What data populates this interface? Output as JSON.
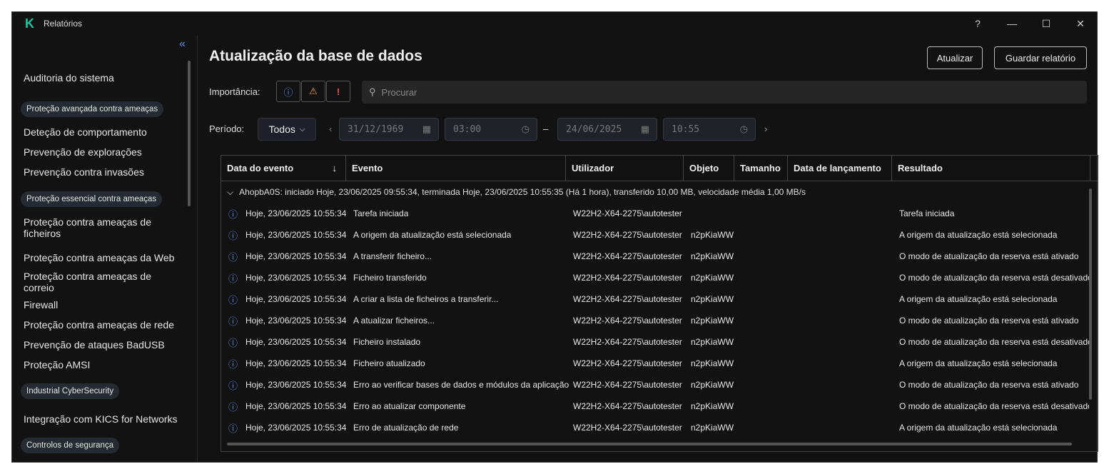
{
  "window": {
    "title": "Relatórios",
    "logo": "K",
    "help": "?",
    "minimize": "—",
    "maximize": "☐",
    "close": "✕"
  },
  "sidebar": {
    "collapse": "«",
    "items": [
      {
        "type": "item",
        "label": "Auditoria do sistema"
      },
      {
        "type": "cat",
        "label": "Proteção avançada contra ameaças"
      },
      {
        "type": "item",
        "label": "Deteção de comportamento"
      },
      {
        "type": "item",
        "label": "Prevenção de explorações"
      },
      {
        "type": "item",
        "label": "Prevenção contra invasões"
      },
      {
        "type": "cat",
        "label": "Proteção essencial contra ameaças"
      },
      {
        "type": "item",
        "label": "Proteção contra ameaças de ficheiros"
      },
      {
        "type": "item",
        "label": "Proteção contra ameaças da Web"
      },
      {
        "type": "item",
        "label": "Proteção contra ameaças de correio"
      },
      {
        "type": "item",
        "label": "Firewall"
      },
      {
        "type": "item",
        "label": "Proteção contra ameaças de rede"
      },
      {
        "type": "item",
        "label": "Prevenção de ataques BadUSB"
      },
      {
        "type": "item",
        "label": "Proteção AMSI"
      },
      {
        "type": "cat",
        "label": "Industrial CyberSecurity"
      },
      {
        "type": "item",
        "label": "Integração com KICS for Networks"
      },
      {
        "type": "cat",
        "label": "Controlos de segurança"
      }
    ]
  },
  "main": {
    "title": "Atualização da base de dados",
    "refresh": "Atualizar",
    "save": "Guardar relatório",
    "importance_label": "Importância:",
    "search_placeholder": "Procurar",
    "period_label": "Período:",
    "period_value": "Todos",
    "from_date": "31/12/1969",
    "from_time": "03:00",
    "dash": "–",
    "to_date": "24/06/2025",
    "to_time": "10:55"
  },
  "table": {
    "columns": [
      "Data do evento",
      "Evento",
      "Utilizador",
      "Objeto",
      "Tamanho",
      "Data de lançamento",
      "Resultado"
    ],
    "sort_icon": "↓",
    "group": "AhopbA0S: iniciado Hoje, 23/06/2025 09:55:34, terminada Hoje, 23/06/2025 10:55:35 (Há 1 hora), transferido 10,00 MB, velocidade média 1,00 MB/s",
    "rows": [
      {
        "date": "Hoje, 23/06/2025 10:55:34",
        "event": "Tarefa iniciada",
        "user": "W22H2-X64-2275\\autotester",
        "object": "",
        "result": "Tarefa iniciada"
      },
      {
        "date": "Hoje, 23/06/2025 10:55:34",
        "event": "A origem da atualização está selecionada",
        "user": "W22H2-X64-2275\\autotester",
        "object": "n2pKiaWW",
        "result": "A origem da atualização está selecionada"
      },
      {
        "date": "Hoje, 23/06/2025 10:55:34",
        "event": "A transferir ficheiro...",
        "user": "W22H2-X64-2275\\autotester",
        "object": "n2pKiaWW",
        "result": "O modo de atualização da reserva está ativado"
      },
      {
        "date": "Hoje, 23/06/2025 10:55:34",
        "event": "Ficheiro transferido",
        "user": "W22H2-X64-2275\\autotester",
        "object": "n2pKiaWW",
        "result": "O modo de atualização da reserva está desativado"
      },
      {
        "date": "Hoje, 23/06/2025 10:55:34",
        "event": "A criar a lista de ficheiros a transferir...",
        "user": "W22H2-X64-2275\\autotester",
        "object": "n2pKiaWW",
        "result": "A origem da atualização está selecionada"
      },
      {
        "date": "Hoje, 23/06/2025 10:55:34",
        "event": "A atualizar ficheiros...",
        "user": "W22H2-X64-2275\\autotester",
        "object": "n2pKiaWW",
        "result": "O modo de atualização da reserva está ativado"
      },
      {
        "date": "Hoje, 23/06/2025 10:55:34",
        "event": "Ficheiro instalado",
        "user": "W22H2-X64-2275\\autotester",
        "object": "n2pKiaWW",
        "result": "O modo de atualização da reserva está desativado"
      },
      {
        "date": "Hoje, 23/06/2025 10:55:34",
        "event": "Ficheiro atualizado",
        "user": "W22H2-X64-2275\\autotester",
        "object": "n2pKiaWW",
        "result": "A origem da atualização está selecionada"
      },
      {
        "date": "Hoje, 23/06/2025 10:55:34",
        "event": "Erro ao verificar bases de dados e módulos da aplicação",
        "user": "W22H2-X64-2275\\autotester",
        "object": "n2pKiaWW",
        "result": "O modo de atualização da reserva está ativado"
      },
      {
        "date": "Hoje, 23/06/2025 10:55:34",
        "event": "Erro ao atualizar componente",
        "user": "W22H2-X64-2275\\autotester",
        "object": "n2pKiaWW",
        "result": "O modo de atualização da reserva está desativado"
      },
      {
        "date": "Hoje, 23/06/2025 10:55:34",
        "event": "Erro de atualização de rede",
        "user": "W22H2-X64-2275\\autotester",
        "object": "n2pKiaWW",
        "result": "A origem da atualização está selecionada"
      }
    ]
  }
}
